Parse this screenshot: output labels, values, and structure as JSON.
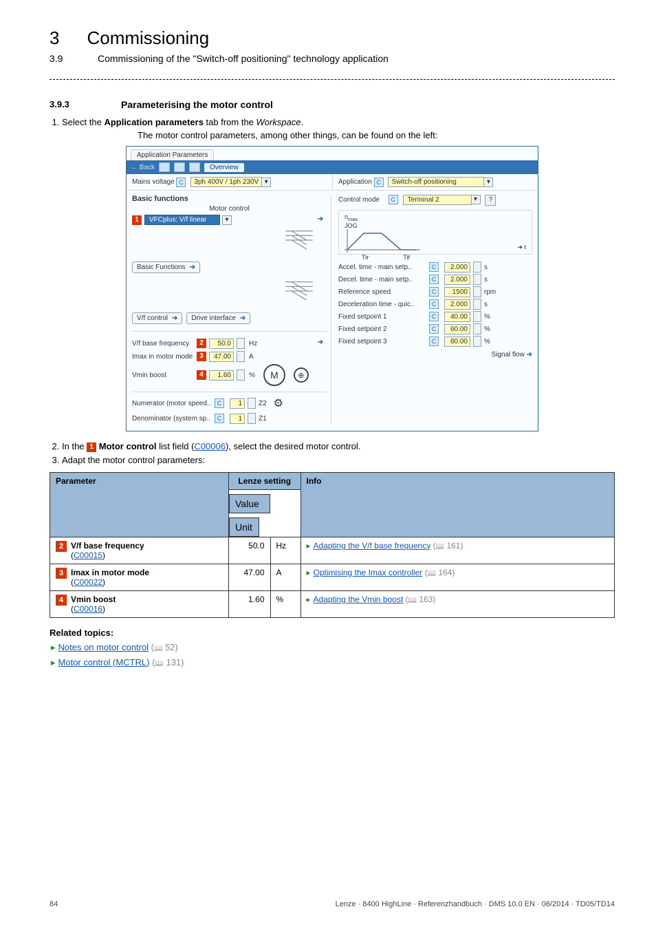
{
  "header": {
    "chapter_num": "3",
    "chapter_title": "Commissioning",
    "section_num": "3.9",
    "section_title": "Commissioning of the \"Switch-off positioning\" technology application"
  },
  "section": {
    "num": "3.9.3",
    "title": "Parameterising the motor control",
    "step1_prefix": "Select the ",
    "step1_bold": "Application parameters",
    "step1_mid": " tab from the ",
    "step1_italic": "Workspace",
    "step1_end": ".",
    "step1_sub": "The motor control parameters, among other things, can be found on the left:",
    "step2_prefix": "In the ",
    "step2_marker": "1",
    "step2_bold": " Motor control",
    "step2_mid": " list field (",
    "step2_link": "C00006",
    "step2_end": "), select the desired motor control.",
    "step3": "Adapt the motor control parameters:"
  },
  "fig": {
    "tab": "Application Parameters",
    "back": "← Back",
    "overview": "Overview",
    "mains_label": "Mains voltage",
    "mains_val": "3ph 400V / 1ph 230V",
    "app_label": "Application",
    "app_val": "Switch-off positioning",
    "basics_title": "Basic functions",
    "motor_control_label": "Motor control",
    "motor_control_val": "VFCplus: V/f linear",
    "basic_functions_btn": "Basic Functions",
    "vf_control_btn": "V/f control",
    "drive_interface_btn": "Drive interface",
    "ctrl_mode_label": "Control mode",
    "ctrl_mode_val": "Terminal 2",
    "p_vfbase_lbl": "V/f base frequency",
    "p_vfbase_val": "50.0",
    "p_vfbase_unit": "Hz",
    "p_imax_lbl": "Imax in motor mode",
    "p_imax_val": "47.00",
    "p_imax_unit": "A",
    "p_vmin_lbl": "Vmin boost",
    "p_vmin_val": "1.60",
    "p_vmin_unit": "%",
    "num_lbl": "Numerator (motor speed..",
    "den_lbl": "Denominator (system sp..",
    "num_val": "1",
    "den_val": "1",
    "z1": "Z1",
    "z2": "Z2",
    "nmax": "n",
    "nmax2": "max",
    "jog": "JOG",
    "t_axis": "t",
    "tir1": "Tir",
    "tir2": "Tif",
    "r_accel_lbl": "Accel. time - main setp..",
    "r_decel_lbl": "Decel. time - main setp..",
    "r_refspd_lbl": "Reference speed",
    "r_dectime_lbl": "Deceleration time - quic..",
    "r_fsp1_lbl": "Fixed setpoint 1",
    "r_fsp2_lbl": "Fixed setpoint 2",
    "r_fsp3_lbl": "Fixed setpoint 3",
    "r_accel_val": "2.000",
    "r_decel_val": "2.000",
    "r_refspd_val": "1500",
    "r_dectime_val": "2.000",
    "r_fsp1_val": "40.00",
    "r_fsp2_val": "60.00",
    "r_fsp3_val": "80.00",
    "u_s": "s",
    "u_rpm": "rpm",
    "u_pct": "%",
    "signal_flow": "Signal flow"
  },
  "table": {
    "h_param": "Parameter",
    "h_lenze": "Lenze setting",
    "h_info": "Info",
    "h_val": "Value",
    "h_unit": "Unit",
    "rows": [
      {
        "mark": "2",
        "name": "V/f base frequency",
        "code": "C00015",
        "val": "50.0",
        "unit": "Hz",
        "info_text": "Adapting the V/f base frequency",
        "info_page": "161"
      },
      {
        "mark": "3",
        "name": "Imax in motor mode",
        "code": "C00022",
        "val": "47.00",
        "unit": "A",
        "info_text": "Optimising the Imax controller",
        "info_page": "164"
      },
      {
        "mark": "4",
        "name": "Vmin boost",
        "code": "C00016",
        "val": "1.60",
        "unit": "%",
        "info_text": "Adapting the Vmin boost",
        "info_page": "163"
      }
    ]
  },
  "related": {
    "title": "Related topics:",
    "items": [
      {
        "text": "Notes on motor control",
        "page": "52"
      },
      {
        "text": "Motor control (MCTRL)",
        "page": "131"
      }
    ]
  },
  "footer": {
    "page": "84",
    "right": "Lenze · 8400 HighLine · Referenzhandbuch · DMS 10.0 EN · 06/2014 · TD05/TD14"
  }
}
